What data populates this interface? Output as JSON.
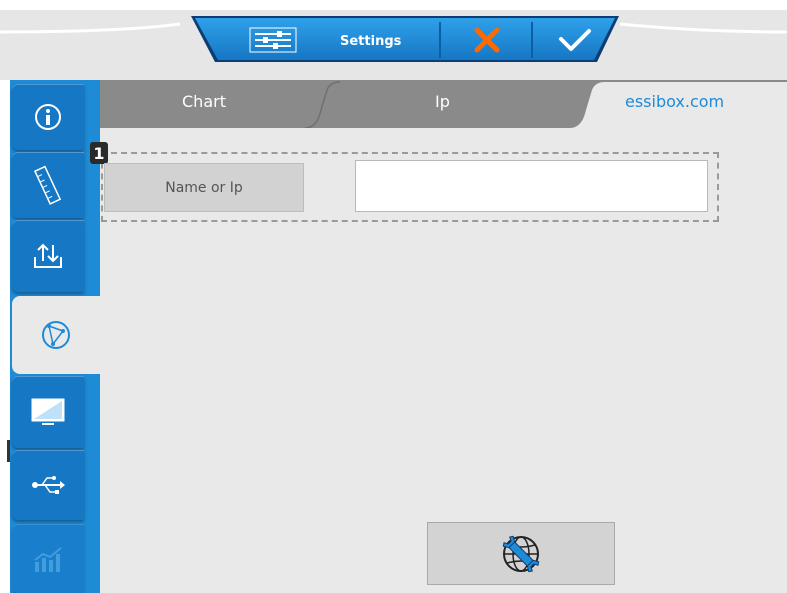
{
  "toolbar": {
    "settings_label": "Settings",
    "sliders_icon": "sliders-icon",
    "cancel_icon": "close-x-icon",
    "confirm_icon": "checkmark-icon",
    "cancel_color": "#ff6a00"
  },
  "sidebar": {
    "items": [
      {
        "icon": "info-icon"
      },
      {
        "icon": "ruler-icon"
      },
      {
        "icon": "upload-download-icon"
      },
      {
        "icon": "network-globe-icon",
        "active": true
      },
      {
        "icon": "monitor-icon"
      },
      {
        "icon": "usb-icon"
      },
      {
        "icon": "chart-icon",
        "disabled": true
      }
    ]
  },
  "tabs": [
    {
      "label": "Chart"
    },
    {
      "label": "Ip"
    },
    {
      "label": "essibox.com",
      "active": true
    }
  ],
  "form": {
    "badge": "1",
    "name_button_label": "Name or Ip",
    "host_value": ""
  },
  "footer": {
    "web_tool_icon": "globe-wrench-icon"
  },
  "colors": {
    "accent_blue": "#1e8bd6",
    "dark_blue": "#1677c4",
    "panel_bg": "#e9e9e9",
    "tab_gray": "#8a8a8a"
  }
}
